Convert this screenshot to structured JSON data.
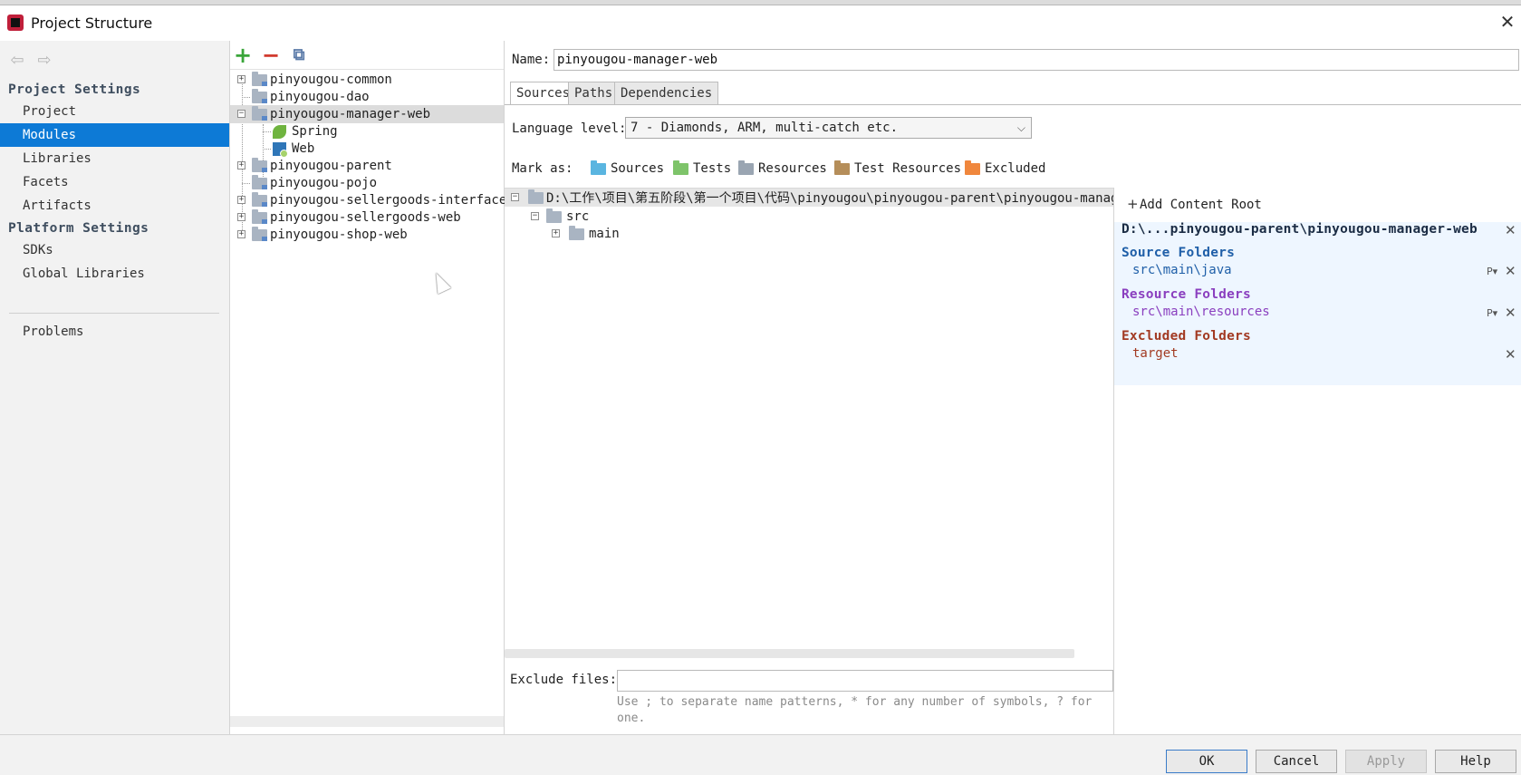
{
  "window": {
    "title": "Project Structure",
    "close_glyph": "✕"
  },
  "sidebar": {
    "back_glyph": "⇦",
    "forward_glyph": "⇨",
    "project_settings_title": "Project Settings",
    "project_items": [
      "Project",
      "Modules",
      "Libraries",
      "Facets",
      "Artifacts"
    ],
    "selected": "Modules",
    "platform_settings_title": "Platform Settings",
    "platform_items": [
      "SDKs",
      "Global Libraries"
    ],
    "problems": "Problems"
  },
  "module_toolbar": {
    "add_glyph": "+",
    "remove_glyph": "−",
    "copy_glyph": "⧉"
  },
  "modules": [
    {
      "label": "pinyougou-common",
      "expandable": true
    },
    {
      "label": "pinyougou-dao",
      "expandable": false
    },
    {
      "label": "pinyougou-manager-web",
      "expandable": true,
      "expanded": true,
      "selected": true
    },
    {
      "label": "Spring",
      "child": true,
      "icon": "spring-leaf-icon"
    },
    {
      "label": "Web",
      "child": true,
      "icon": "web-facet-icon"
    },
    {
      "label": "pinyougou-parent",
      "expandable": true
    },
    {
      "label": "pinyougou-pojo",
      "expandable": false
    },
    {
      "label": "pinyougou-sellergoods-interface",
      "expandable": true
    },
    {
      "label": "pinyougou-sellergoods-web",
      "expandable": true
    },
    {
      "label": "pinyougou-shop-web",
      "expandable": true
    }
  ],
  "editor": {
    "name_label": "Name:",
    "name_value": "pinyougou-manager-web",
    "tabs": [
      "Sources",
      "Paths",
      "Dependencies"
    ],
    "active_tab": "Sources",
    "language_label": "Language level:",
    "language_value": "7 - Diamonds, ARM, multi-catch etc.",
    "mark_as_label": "Mark as:",
    "mark_as": [
      {
        "label": "Sources",
        "color": "#5ab5e0"
      },
      {
        "label": "Tests",
        "color": "#7ec46a"
      },
      {
        "label": "Resources",
        "color": "#9aa5b2"
      },
      {
        "label": "Test Resources",
        "color": "#b58e5a"
      },
      {
        "label": "Excluded",
        "color": "#f0873d"
      }
    ]
  },
  "content_tree": {
    "root": "D:\\工作\\项目\\第五阶段\\第一个项目\\代码\\pinyougou\\pinyougou-parent\\pinyougou-manag",
    "src": "src",
    "main": "main"
  },
  "roots_panel": {
    "add_label": "Add Content Root",
    "add_glyph": "+",
    "root_path": "D:\\...pinyougou-parent\\pinyougou-manager-web",
    "source_title": "Source Folders",
    "source_path": "src\\main\\java",
    "resource_title": "Resource Folders",
    "resource_path": "src\\main\\resources",
    "excluded_title": "Excluded Folders",
    "excluded_path": "target",
    "source_color": "#1f5fa8",
    "resource_color": "#8a3fbf",
    "excluded_color": "#a23a22",
    "remove_glyph": "✕",
    "props_glyph": "P▾"
  },
  "exclude": {
    "label": "Exclude files:",
    "hint": "Use ; to separate name patterns, * for any number of symbols, ? for one."
  },
  "buttons": {
    "ok": "OK",
    "cancel": "Cancel",
    "apply": "Apply",
    "help": "Help"
  }
}
